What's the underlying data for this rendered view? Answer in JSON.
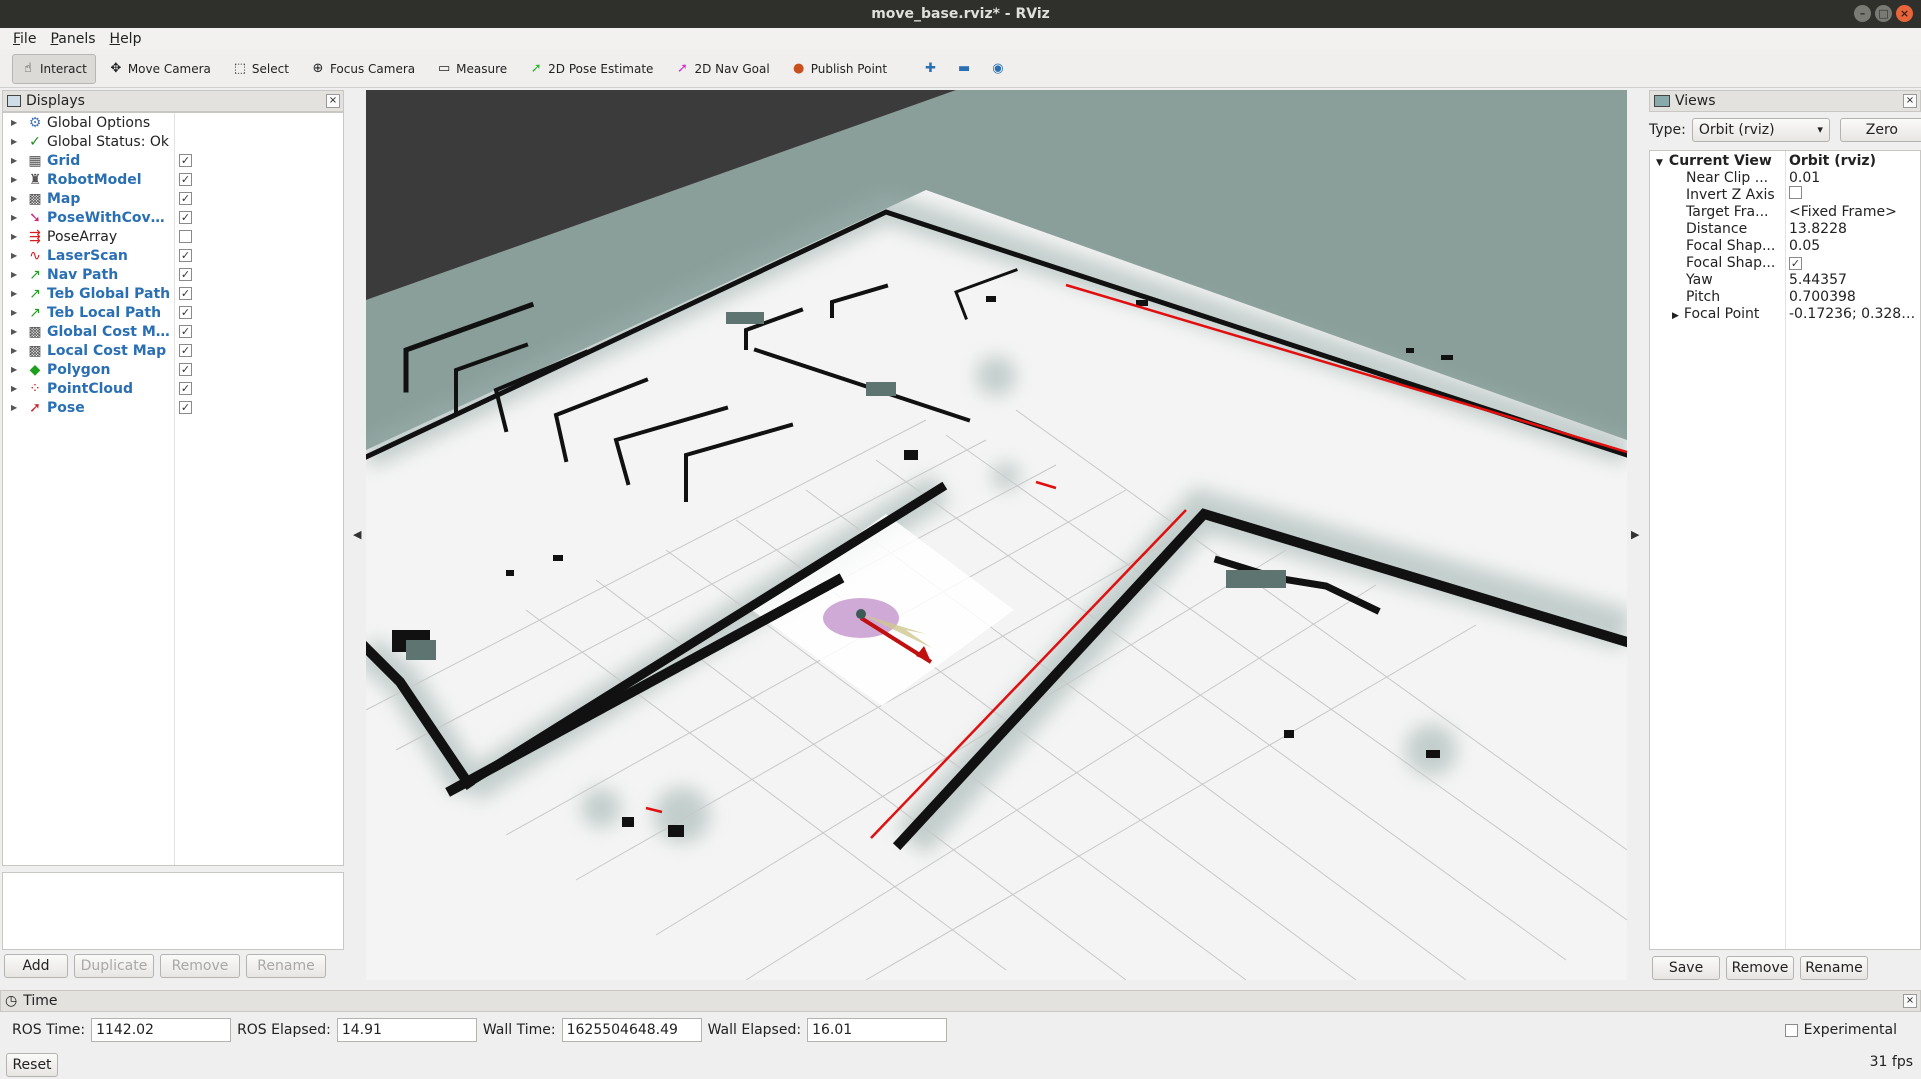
{
  "window": {
    "title": "move_base.rviz* - RViz"
  },
  "menu": [
    "File",
    "Panels",
    "Help"
  ],
  "toolbar": {
    "tools": [
      {
        "label": "Interact",
        "icon": "hand-icon",
        "glyph": "☝",
        "active": true
      },
      {
        "label": "Move Camera",
        "icon": "move-camera-icon",
        "glyph": "✥"
      },
      {
        "label": "Select",
        "icon": "select-icon",
        "glyph": "⬚"
      },
      {
        "label": "Focus Camera",
        "icon": "focus-camera-icon",
        "glyph": "⊕"
      },
      {
        "label": "Measure",
        "icon": "measure-icon",
        "glyph": "▭"
      },
      {
        "label": "2D Pose Estimate",
        "icon": "pose-estimate-arrow-icon",
        "glyph": "➚",
        "color": "#2bb52b"
      },
      {
        "label": "2D Nav Goal",
        "icon": "nav-goal-arrow-icon",
        "glyph": "➚",
        "color": "#d42bd4"
      },
      {
        "label": "Publish Point",
        "icon": "map-pin-icon",
        "glyph": "●",
        "color": "#c8501e"
      }
    ]
  },
  "displays": {
    "title": "Displays",
    "items": [
      {
        "label": "Global Options",
        "icon": "gear-icon",
        "glyph": "⚙",
        "color": "#4a7bbf",
        "checkbox": null,
        "highlight": false
      },
      {
        "label": "Global Status: Ok",
        "icon": "check-icon",
        "glyph": "✓",
        "color": "#1e8c1e",
        "checkbox": null,
        "highlight": false
      },
      {
        "label": "Grid",
        "icon": "grid-icon",
        "glyph": "▦",
        "color": "#555",
        "checkbox": true,
        "highlight": true
      },
      {
        "label": "RobotModel",
        "icon": "robot-icon",
        "glyph": "♜",
        "color": "#555",
        "checkbox": true,
        "highlight": true
      },
      {
        "label": "Map",
        "icon": "map-icon",
        "glyph": "▩",
        "color": "#555",
        "checkbox": true,
        "highlight": true
      },
      {
        "label": "PoseWithCova...",
        "icon": "pose-cov-arrow-icon",
        "glyph": "➘",
        "color": "#d4206f",
        "checkbox": true,
        "highlight": true
      },
      {
        "label": "PoseArray",
        "icon": "pose-array-icon",
        "glyph": "⇶",
        "color": "#d42020",
        "checkbox": false,
        "highlight": false
      },
      {
        "label": "LaserScan",
        "icon": "laser-scan-icon",
        "glyph": "∿",
        "color": "#d42020",
        "checkbox": true,
        "highlight": true
      },
      {
        "label": "Nav Path",
        "icon": "path-icon",
        "glyph": "↗",
        "color": "#1ea01e",
        "checkbox": true,
        "highlight": true
      },
      {
        "label": "Teb Global Path",
        "icon": "path-icon",
        "glyph": "↗",
        "color": "#1ea01e",
        "checkbox": true,
        "highlight": true
      },
      {
        "label": "Teb Local Path",
        "icon": "path-icon",
        "glyph": "↗",
        "color": "#1ea01e",
        "checkbox": true,
        "highlight": true
      },
      {
        "label": "Global Cost Map",
        "icon": "map-icon",
        "glyph": "▩",
        "color": "#555",
        "checkbox": true,
        "highlight": true
      },
      {
        "label": "Local Cost Map",
        "icon": "map-icon",
        "glyph": "▩",
        "color": "#555",
        "checkbox": true,
        "highlight": true
      },
      {
        "label": "Polygon",
        "icon": "polygon-icon",
        "glyph": "◆",
        "color": "#1ea01e",
        "checkbox": true,
        "highlight": true
      },
      {
        "label": "PointCloud",
        "icon": "point-cloud-icon",
        "glyph": "⁘",
        "color": "#d42020",
        "checkbox": true,
        "highlight": true
      },
      {
        "label": "Pose",
        "icon": "pose-arrow-icon",
        "glyph": "➚",
        "color": "#d42020",
        "checkbox": true,
        "highlight": true
      }
    ],
    "buttons": {
      "add": "Add",
      "duplicate": "Duplicate",
      "remove": "Remove",
      "rename": "Rename"
    }
  },
  "views": {
    "title": "Views",
    "type_label": "Type:",
    "type_value": "Orbit (rviz)",
    "zero": "Zero",
    "header_key": "Current View",
    "header_value": "Orbit (rviz)",
    "props": [
      {
        "key": "Near Clip ...",
        "value": "0.01"
      },
      {
        "key": "Invert Z Axis",
        "value": "",
        "checkbox": false
      },
      {
        "key": "Target Fra...",
        "value": "<Fixed Frame>"
      },
      {
        "key": "Distance",
        "value": "13.8228"
      },
      {
        "key": "Focal Shap...",
        "value": "0.05"
      },
      {
        "key": "Focal Shap...",
        "value": "",
        "checkbox": true
      },
      {
        "key": "Yaw",
        "value": "5.44357"
      },
      {
        "key": "Pitch",
        "value": "0.700398"
      },
      {
        "key": "Focal Point",
        "value": "-0.17236; 0.3280...",
        "expandable": true
      }
    ],
    "buttons": {
      "save": "Save",
      "remove": "Remove",
      "rename": "Rename"
    }
  },
  "time": {
    "title": "Time",
    "ros_time_label": "ROS Time:",
    "ros_time": "1142.02",
    "ros_elapsed_label": "ROS Elapsed:",
    "ros_elapsed": "14.91",
    "wall_time_label": "Wall Time:",
    "wall_time": "1625504648.49",
    "wall_elapsed_label": "Wall Elapsed:",
    "wall_elapsed": "16.01",
    "experimental": "Experimental",
    "reset": "Reset",
    "fps": "31 fps"
  },
  "colors": {
    "background_fill": "#8a9e9a",
    "map_floor": "#f4f4f4",
    "laser": "#e01010",
    "robot_footprint": "#c89bd0"
  }
}
